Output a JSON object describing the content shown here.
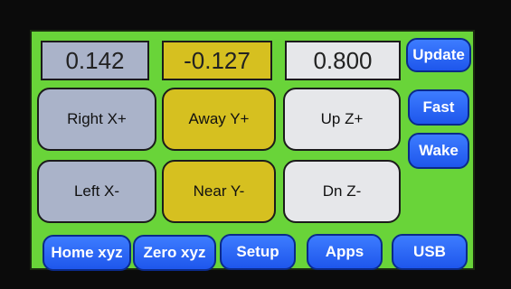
{
  "colors": {
    "screen_bg": "#69d439",
    "x_panel": "#aab3c9",
    "y_panel": "#d6c020",
    "z_panel": "#e6e7ea",
    "blue_button": "#2a66f5"
  },
  "readouts": {
    "x": "0.142",
    "y": "-0.127",
    "z": "0.800"
  },
  "jog": {
    "right_x": "Right X+",
    "away_y": "Away Y+",
    "up_z": "Up Z+",
    "left_x": "Left X-",
    "near_y": "Near Y-",
    "dn_z": "Dn Z-"
  },
  "side": {
    "update": "Update",
    "fast": "Fast",
    "wake": "Wake"
  },
  "bottom": {
    "home": "Home xyz",
    "zero": "Zero xyz",
    "setup": "Setup",
    "apps": "Apps",
    "usb": "USB"
  }
}
